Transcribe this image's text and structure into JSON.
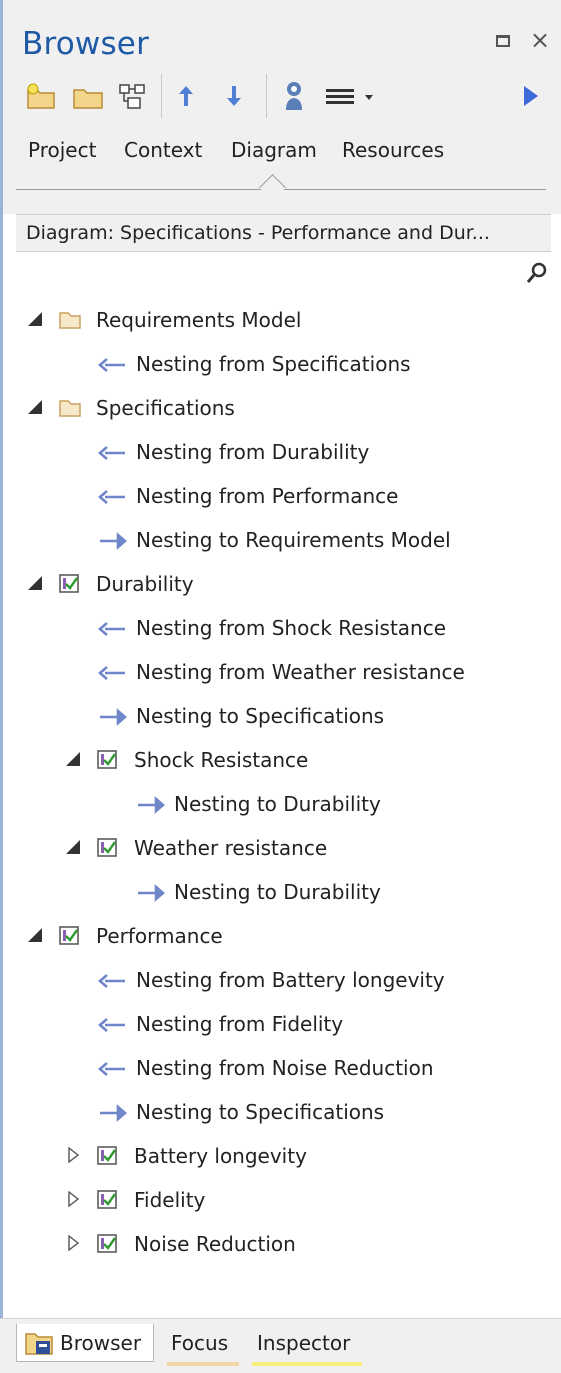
{
  "window": {
    "title": "Browser",
    "maximize_icon": "maximize-icon",
    "close_icon": "close-icon",
    "close_glyph": "×"
  },
  "toolbar": {
    "buttons": [
      {
        "icon": "new-package-icon"
      },
      {
        "icon": "folder-icon"
      },
      {
        "icon": "diagram-icon"
      },
      {
        "icon": "move-up-icon"
      },
      {
        "icon": "move-down-icon"
      },
      {
        "icon": "user-settings-icon"
      },
      {
        "icon": "menu-icon"
      },
      {
        "icon": "play-icon"
      }
    ]
  },
  "tabs": [
    "Project",
    "Context",
    "Diagram",
    "Resources"
  ],
  "active_tab": "Diagram",
  "diagram_bar": {
    "text": "Diagram: Specifications - Performance and Dur..."
  },
  "tree": [
    {
      "kind": "folder",
      "label": "Requirements Model",
      "expanded": true
    },
    {
      "kind": "from",
      "label": "Nesting from Specifications"
    },
    {
      "kind": "folder",
      "label": "Specifications",
      "expanded": true
    },
    {
      "kind": "from",
      "label": "Nesting from Durability"
    },
    {
      "kind": "from",
      "label": "Nesting from Performance"
    },
    {
      "kind": "to",
      "label": "Nesting to Requirements Model"
    },
    {
      "kind": "requirement",
      "label": "Durability",
      "expanded": true
    },
    {
      "kind": "from",
      "label": "Nesting from Shock Resistance"
    },
    {
      "kind": "from",
      "label": "Nesting from Weather resistance"
    },
    {
      "kind": "to",
      "label": "Nesting to Specifications"
    },
    {
      "kind": "requirement",
      "label": "Shock Resistance",
      "expanded": true
    },
    {
      "kind": "to",
      "label": "Nesting to Durability"
    },
    {
      "kind": "requirement",
      "label": "Weather resistance",
      "expanded": true
    },
    {
      "kind": "to",
      "label": "Nesting to Durability"
    },
    {
      "kind": "requirement",
      "label": "Performance",
      "expanded": true
    },
    {
      "kind": "from",
      "label": "Nesting from Battery longevity"
    },
    {
      "kind": "from",
      "label": "Nesting from Fidelity"
    },
    {
      "kind": "from",
      "label": "Nesting from Noise Reduction"
    },
    {
      "kind": "to",
      "label": "Nesting to Specifications"
    },
    {
      "kind": "requirement",
      "label": "Battery longevity",
      "expanded": false
    },
    {
      "kind": "requirement",
      "label": "Fidelity",
      "expanded": false
    },
    {
      "kind": "requirement",
      "label": "Noise Reduction",
      "expanded": false
    }
  ],
  "bottom_tabs": [
    "Browser",
    "Focus",
    "Inspector"
  ],
  "colors": {
    "title": "#1f5aa6",
    "arrow": "#6f86c9",
    "folder": "#f6e8c8",
    "folder_stroke": "#c8a25e",
    "req_check": "#2e9c2e",
    "req_box": "#8a5fb2"
  }
}
